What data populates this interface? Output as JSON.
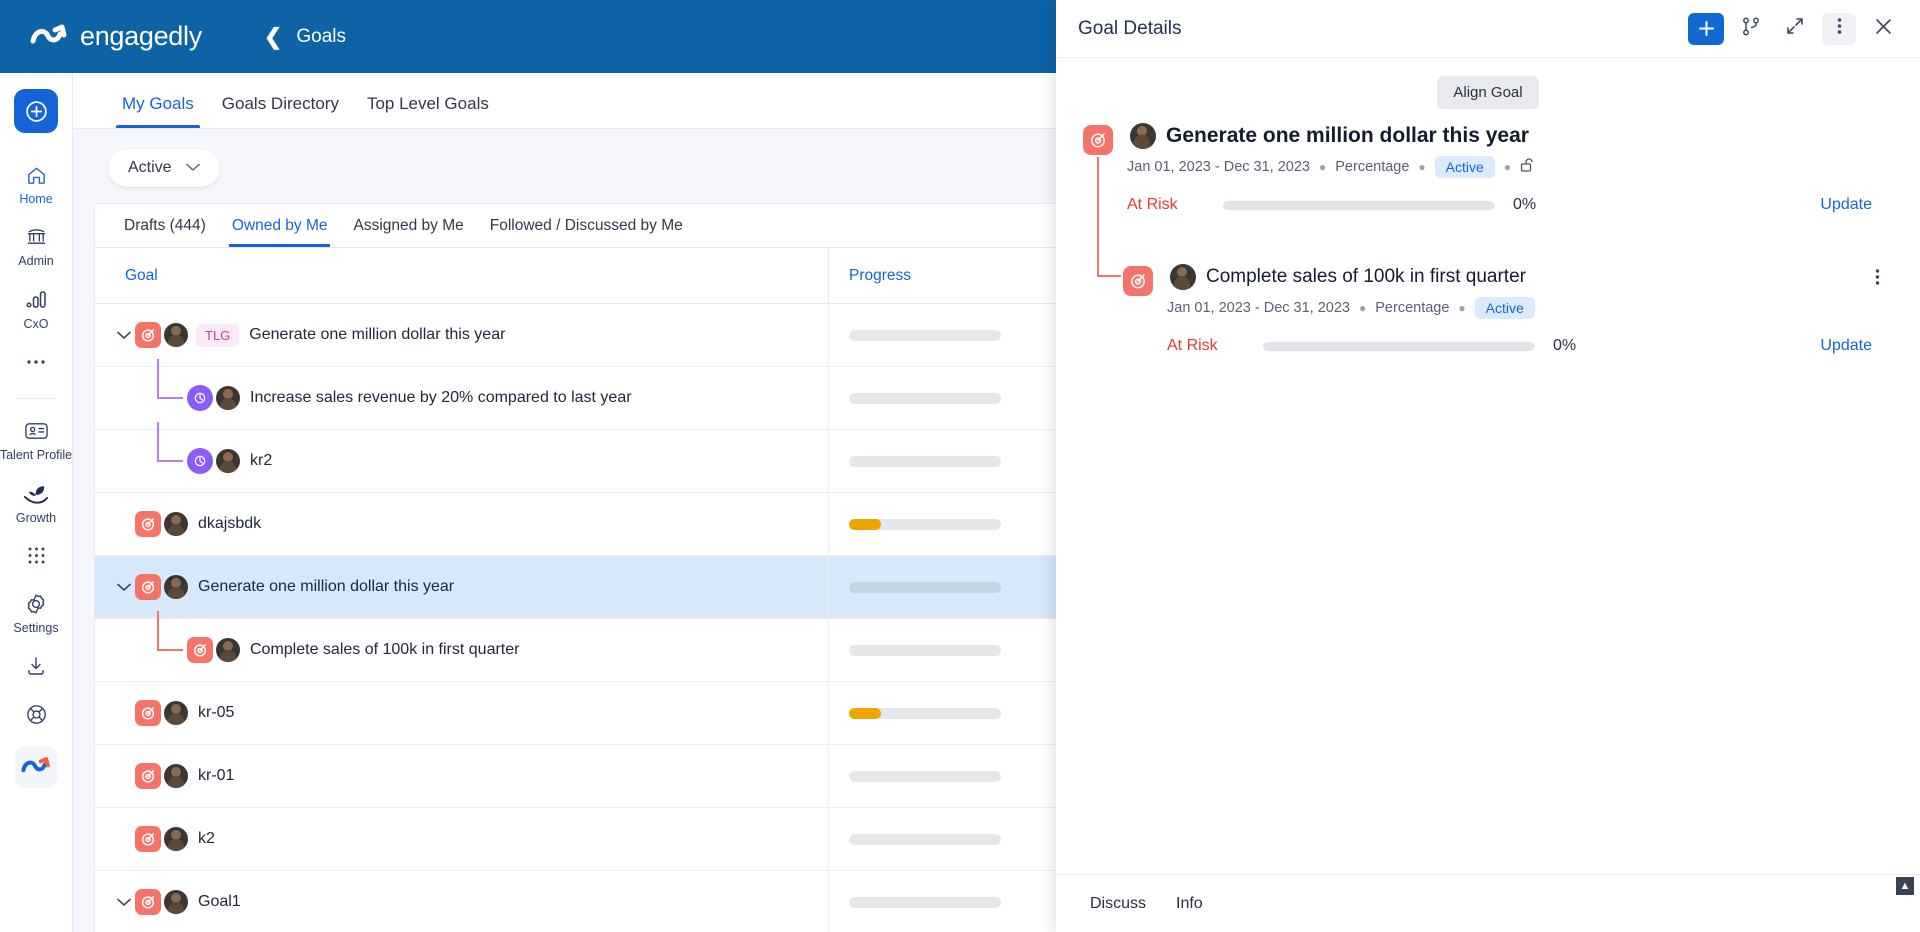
{
  "brand": {
    "name": "engagedly",
    "logo_icon": "engagedly-logo-icon"
  },
  "breadcrumb": {
    "back_icon": "chevron-left-icon",
    "label": "Goals"
  },
  "rail": {
    "add_icon": "plus-circle-icon",
    "items": [
      {
        "label": "Home",
        "icon": "home-icon",
        "active": true
      },
      {
        "label": "Admin",
        "icon": "bank-icon",
        "active": false
      },
      {
        "label": "CxO",
        "icon": "bar-chart-icon",
        "active": false
      },
      {
        "label": "",
        "icon": "more-horizontal-icon",
        "active": false
      },
      {
        "label": "Talent Profile",
        "icon": "id-card-icon",
        "active": false
      },
      {
        "label": "Growth",
        "icon": "growth-plant-icon",
        "active": false
      },
      {
        "label": "",
        "icon": "grid-apps-icon",
        "active": false
      },
      {
        "label": "Settings",
        "icon": "gear-icon",
        "active": false
      },
      {
        "label": "",
        "icon": "download-icon",
        "active": false
      },
      {
        "label": "",
        "icon": "lifebuoy-help-icon",
        "active": false
      }
    ]
  },
  "main": {
    "tabs": [
      {
        "label": "My Goals",
        "active": true
      },
      {
        "label": "Goals Directory",
        "active": false
      },
      {
        "label": "Top Level Goals",
        "active": false
      }
    ],
    "filter": {
      "label": "Active",
      "chevron_icon": "chevron-down-icon"
    },
    "subtabs": [
      {
        "label": "Drafts (444)",
        "active": false
      },
      {
        "label": "Owned by Me",
        "active": true
      },
      {
        "label": "Assigned by Me",
        "active": false
      },
      {
        "label": "Followed / Discussed by Me",
        "active": false
      }
    ],
    "columns": {
      "goal": "Goal",
      "progress": "Progress"
    },
    "rows": [
      {
        "title": "Generate one million dollar this year",
        "type": "goal",
        "level": 0,
        "expanded": true,
        "badge": "TLG",
        "progress": 0,
        "selected": false
      },
      {
        "title": "Increase sales revenue by 20% compared to last year",
        "type": "kr",
        "level": 1,
        "expanded": false,
        "badge": "",
        "progress": 0,
        "selected": false
      },
      {
        "title": "kr2",
        "type": "kr",
        "level": 1,
        "expanded": false,
        "badge": "",
        "progress": 0,
        "selected": false
      },
      {
        "title": "dkajsbdk",
        "type": "goal",
        "level": 0,
        "expanded": false,
        "badge": "",
        "progress": 21,
        "selected": false
      },
      {
        "title": "Generate one million dollar this year",
        "type": "goal",
        "level": 0,
        "expanded": true,
        "badge": "",
        "progress": 0,
        "selected": true
      },
      {
        "title": "Complete sales of 100k in first quarter",
        "type": "goal",
        "level": 1,
        "expanded": false,
        "badge": "",
        "progress": 0,
        "selected": false
      },
      {
        "title": "kr-05",
        "type": "goal",
        "level": 0,
        "expanded": false,
        "badge": "",
        "progress": 21,
        "selected": false
      },
      {
        "title": "kr-01",
        "type": "goal",
        "level": 0,
        "expanded": false,
        "badge": "",
        "progress": 0,
        "selected": false
      },
      {
        "title": "k2",
        "type": "goal",
        "level": 0,
        "expanded": false,
        "badge": "",
        "progress": 0,
        "selected": false
      },
      {
        "title": "Goal1",
        "type": "goal",
        "level": 0,
        "expanded": true,
        "badge": "",
        "progress": 0,
        "selected": false
      }
    ]
  },
  "detail": {
    "title": "Goal Details",
    "actions": [
      {
        "name": "add-button",
        "icon": "plus-icon"
      },
      {
        "name": "align-branch-button",
        "icon": "git-branch-icon"
      },
      {
        "name": "expand-button",
        "icon": "expand-arrows-icon"
      },
      {
        "name": "more-options-button",
        "icon": "kebab-vertical-icon"
      },
      {
        "name": "close-button",
        "icon": "close-x-icon"
      }
    ],
    "align_goal_label": "Align Goal",
    "goals": [
      {
        "title": "Generate one million dollar this year",
        "dates": "Jan 01, 2023 - Dec 31, 2023",
        "metric": "Percentage",
        "status": "Active",
        "lock_icon": "unlock-icon",
        "risk": "At Risk",
        "progress_pct": "0%",
        "progress_value": 0,
        "update_label": "Update",
        "has_kebab": false
      },
      {
        "title": "Complete sales of 100k in first quarter",
        "dates": "Jan 01, 2023 - Dec 31, 2023",
        "metric": "Percentage",
        "status": "Active",
        "lock_icon": "",
        "risk": "At Risk",
        "progress_pct": "0%",
        "progress_value": 0,
        "update_label": "Update",
        "has_kebab": true
      }
    ],
    "footer_tabs": [
      {
        "label": "Discuss"
      },
      {
        "label": "Info"
      }
    ],
    "scroll_top_icon": "chevron-up-icon"
  },
  "colors": {
    "brand_blue": "#0d63a5",
    "accent_blue": "#1565d8",
    "goal_red": "#f4746a",
    "kr_purple": "#8b5cf6",
    "risk_red": "#e63b2e",
    "progress_amber": "#f0a400",
    "selected_row": "#d7e8fa"
  }
}
